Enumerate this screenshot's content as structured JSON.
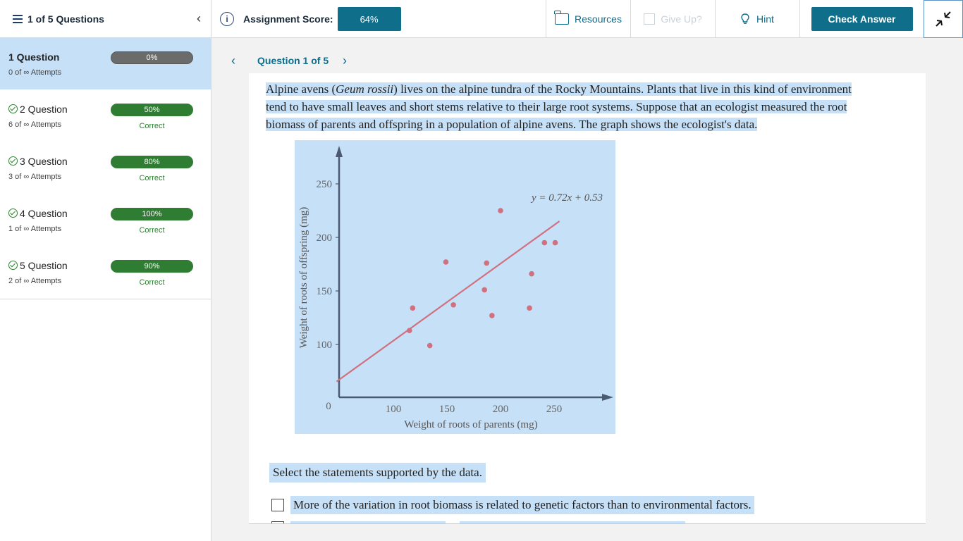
{
  "topbar": {
    "question_count": "1 of 5 Questions",
    "score_label": "Assignment Score:",
    "score_value": "64%",
    "resources": "Resources",
    "give_up": "Give Up?",
    "hint": "Hint",
    "check_answer": "Check Answer"
  },
  "sidebar": {
    "items": [
      {
        "title": "1 Question",
        "attempts": "0 of ∞ Attempts",
        "percent": "0%",
        "status": "",
        "bar_color": "#6b6b6b"
      },
      {
        "title": "2 Question",
        "attempts": "6 of ∞ Attempts",
        "percent": "50%",
        "status": "Correct",
        "bar_color": "#2e7d32"
      },
      {
        "title": "3 Question",
        "attempts": "3 of ∞ Attempts",
        "percent": "80%",
        "status": "Correct",
        "bar_color": "#2e7d32"
      },
      {
        "title": "4 Question",
        "attempts": "1 of ∞ Attempts",
        "percent": "100%",
        "status": "Correct",
        "bar_color": "#2e7d32"
      },
      {
        "title": "5 Question",
        "attempts": "2 of ∞ Attempts",
        "percent": "90%",
        "status": "Correct",
        "bar_color": "#2e7d32"
      }
    ]
  },
  "question": {
    "nav_label": "Question 1 of 5",
    "passage_line1_a": "Alpine avens (",
    "passage_species": "Geum rossii",
    "passage_line1_b": ") lives on the alpine tundra of the Rocky Mountains. Plants that live in this kind of environment",
    "passage_line2": "tend to have small leaves and short stems relative to their large root systems. Suppose that an ecologist measured the root",
    "passage_line3": "biomass of parents and offspring in a population of alpine avens. The graph shows the ecologist's data.",
    "prompt": "Select the statements supported by the data.",
    "option1": "More of the variation in root biomass is related to genetic factors than to environmental factors."
  },
  "chart_data": {
    "type": "scatter",
    "xlabel": "Weight of roots of parents (mg)",
    "ylabel": "Weight of roots of offspring (mg)",
    "equation": "y = 0.72x + 0.53",
    "x_ticks": [
      "100",
      "150",
      "200",
      "250"
    ],
    "y_ticks": [
      "100",
      "150",
      "200",
      "250"
    ],
    "origin_label": "0",
    "points": [
      {
        "x": 115,
        "y": 113
      },
      {
        "x": 118,
        "y": 134
      },
      {
        "x": 134,
        "y": 99
      },
      {
        "x": 149,
        "y": 177
      },
      {
        "x": 156,
        "y": 137
      },
      {
        "x": 185,
        "y": 151
      },
      {
        "x": 187,
        "y": 176
      },
      {
        "x": 192,
        "y": 127
      },
      {
        "x": 200,
        "y": 225
      },
      {
        "x": 227,
        "y": 134
      },
      {
        "x": 229,
        "y": 166
      },
      {
        "x": 241,
        "y": 195
      },
      {
        "x": 251,
        "y": 195
      }
    ],
    "fit": {
      "slope": 0.72,
      "intercept": 0.53
    },
    "colors": {
      "points": "#d0717f",
      "line": "#d0717f",
      "axes": "#4a5a70",
      "background": "#c6e0f8"
    }
  }
}
